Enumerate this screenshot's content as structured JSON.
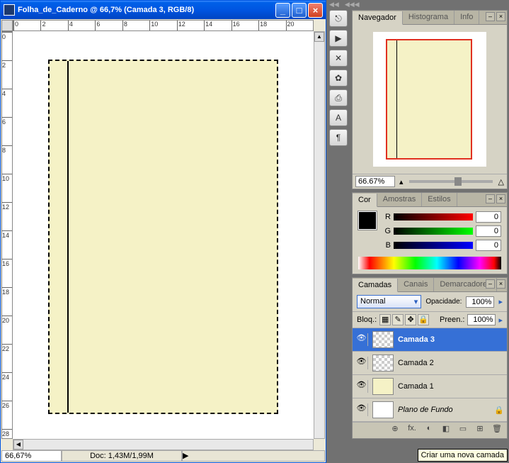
{
  "window": {
    "title": "Folha_de_Caderno @ 66,7% (Camada 3, RGB/8)"
  },
  "status": {
    "zoom": "66,67%",
    "doc": "Doc: 1,43M/1,99M"
  },
  "ruler_h": [
    "0",
    "2",
    "4",
    "6",
    "8",
    "10",
    "12",
    "14",
    "16",
    "18",
    "20"
  ],
  "ruler_v": [
    "0",
    "2",
    "4",
    "6",
    "8",
    "10",
    "12",
    "14",
    "16",
    "18",
    "20",
    "22",
    "24",
    "26",
    "28"
  ],
  "navigator": {
    "tabs": [
      "Navegador",
      "Histograma",
      "Info"
    ],
    "zoom": "66.67%"
  },
  "color": {
    "tabs": [
      "Cor",
      "Amostras",
      "Estilos"
    ],
    "channels": [
      {
        "label": "R",
        "value": "0"
      },
      {
        "label": "G",
        "value": "0"
      },
      {
        "label": "B",
        "value": "0"
      }
    ]
  },
  "layers": {
    "tabs": [
      "Camadas",
      "Canais",
      "Demarcadores"
    ],
    "blend_mode": "Normal",
    "opacity_label": "Opacidade:",
    "opacity": "100%",
    "lock_label": "Bloq.:",
    "fill_label": "Preen.:",
    "fill": "100%",
    "items": [
      {
        "name": "Camada 3"
      },
      {
        "name": "Camada 2"
      },
      {
        "name": "Camada 1"
      },
      {
        "name": "Plano de Fundo"
      }
    ],
    "footer_icons": [
      "⊕",
      "fx.",
      "◐",
      "◧",
      "▭",
      "⊞",
      "🗑"
    ]
  },
  "tooltip": "Criar uma nova camada"
}
